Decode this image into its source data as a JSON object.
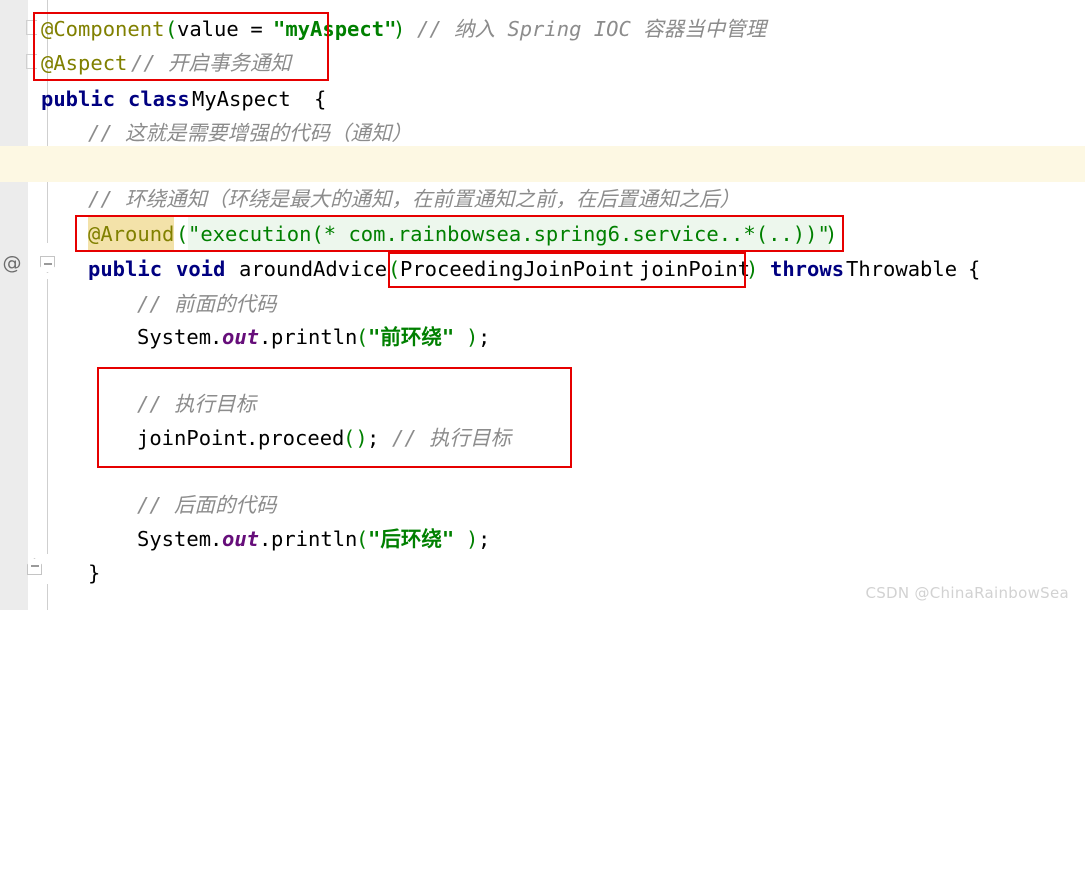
{
  "editor": {
    "watermark": "CSDN @ChinaRainbowSea",
    "gutter_at_icon": "@",
    "colors": {
      "background": "#ffffff",
      "gutter": "#ececec",
      "caret_line": "#fdf8e3",
      "annotation": "#808000",
      "keyword": "#000080",
      "string": "#008000",
      "comment": "#8c8c8c",
      "field": "#660e7a",
      "string_background": "#edf7ed",
      "search_highlight": "#f3e2a9",
      "redbox_border": "#e60000",
      "watermark": "#d2d2d2"
    }
  },
  "code": {
    "line1": {
      "annotation": "@Component",
      "open_paren": "(",
      "param_name": "value",
      "equals": " = ",
      "value": "\"myAspect\"",
      "close_paren": ")",
      "comment": "// 纳入 Spring IOC 容器当中管理"
    },
    "line2": {
      "annotation": "@Aspect",
      "comment": "// 开启事务通知"
    },
    "line3": {
      "modifier": "public",
      "keyword_class": "class",
      "class_name": "MyAspect",
      "brace": "{"
    },
    "line4": {
      "comment": "// 这就是需要增强的代码（通知）"
    },
    "line5": {
      "comment": ""
    },
    "line6": {
      "comment": "// 环绕通知（环绕是最大的通知，在前置通知之前，在后置通知之后）"
    },
    "line7": {
      "annotation": "@Around",
      "open_paren": "(",
      "pointcut": "\"execution(* com.rainbowsea.spring6.service..*(..))\"",
      "close_paren": ")"
    },
    "line8": {
      "modifier": "public",
      "return_type": "void",
      "method_name": "aroundAdvice",
      "open_paren": "(",
      "param_type": "ProceedingJoinPoint",
      "param_name": "joinPoint",
      "close_paren": ")",
      "throws_keyword": "throws",
      "exception": "Throwable",
      "brace": "{"
    },
    "line9": {
      "comment": "// 前面的代码"
    },
    "line10": {
      "object": "System",
      "dot1": ".",
      "field": "out",
      "dot2": ".",
      "method": "println",
      "open_paren": "(",
      "argument": "\"前环绕\"",
      "close_paren": ")",
      "semicolon": ";"
    },
    "line11": {
      "comment": "// 执行目标"
    },
    "line12": {
      "object": "joinPoint",
      "dot": ".",
      "method": "proceed",
      "parens": "()",
      "semicolon": ";",
      "comment": "// 执行目标"
    },
    "line13": {
      "comment": "// 后面的代码"
    },
    "line14": {
      "object": "System",
      "dot1": ".",
      "field": "out",
      "dot2": ".",
      "method": "println",
      "open_paren": "(",
      "argument": "\"后环绕\"",
      "close_paren": ")",
      "semicolon": ";"
    },
    "line15": {
      "brace": "}"
    }
  },
  "annotations": {
    "box1_label": "component-aspect-annotations-box",
    "box2_label": "around-pointcut-box",
    "box3_label": "proceeding-joinpoint-param-box",
    "box4_label": "proceed-target-box"
  }
}
